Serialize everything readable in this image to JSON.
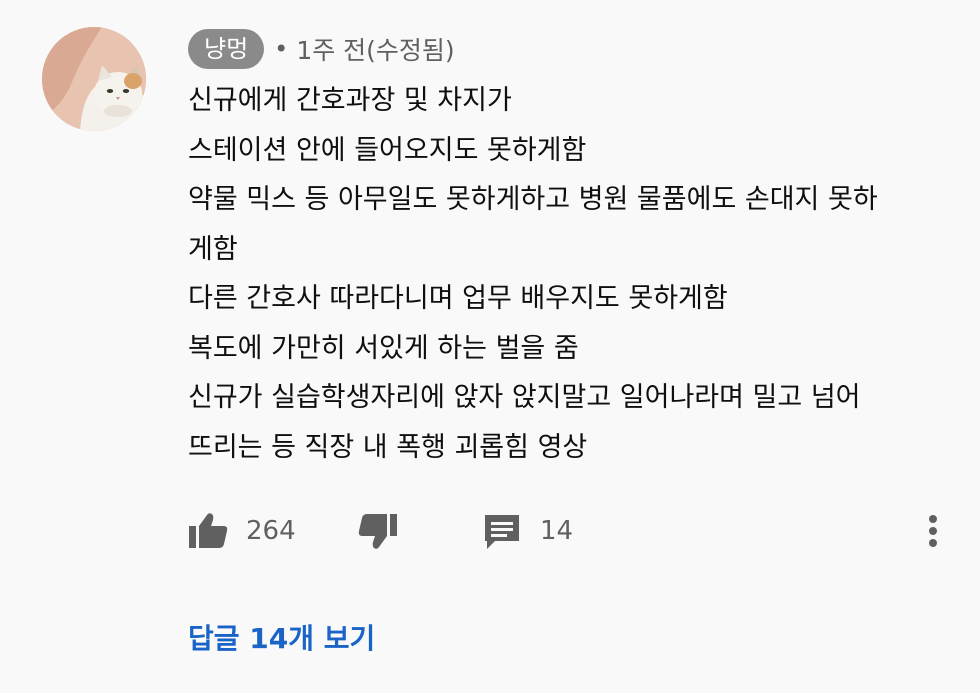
{
  "comment": {
    "author": "냥멍",
    "separator": "•",
    "time": "1주 전(수정됨)",
    "lines": [
      "신규에게 간호과장 및 차지가",
      "스테이션 안에 들어오지도 못하게함",
      "약물 믹스 등 아무일도 못하게하고 병원 물품에도 손대지 못하",
      "게함",
      "다른 간호사 따라다니며 업무 배우지도 못하게함",
      "복도에 가만히 서있게 하는 벌을 줌",
      "신규가 실습학생자리에 앉자 앉지말고 일어나라며 밀고 넘어",
      "뜨리는 등 직장 내 폭행 괴롭힘 영상"
    ],
    "like_count": "264",
    "reply_count": "14",
    "view_replies": "답글 14개 보기"
  },
  "icons": {
    "avatar": "cat-avatar",
    "like": "thumbs-up-icon",
    "dislike": "thumbs-down-icon",
    "reply": "comment-icon",
    "more": "more-vertical-icon"
  },
  "colors": {
    "background": "#f9f9f9",
    "badge": "#8a8a8a",
    "link": "#1a64c8",
    "secondary_text": "#606060",
    "icon": "#606060"
  }
}
